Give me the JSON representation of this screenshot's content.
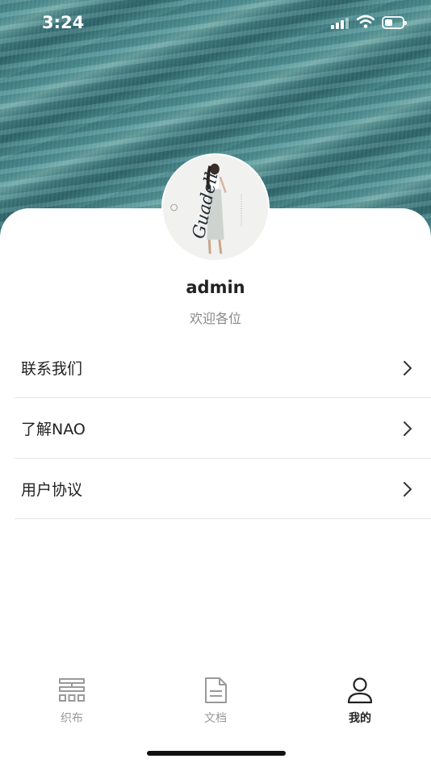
{
  "status_bar": {
    "time": "3:24",
    "battery_level": 0.45
  },
  "profile": {
    "username": "admin",
    "tagline": "欢迎各位",
    "avatar_text": "Guadell"
  },
  "menu": {
    "items": [
      {
        "label": "联系我们"
      },
      {
        "label": "了解NAO"
      },
      {
        "label": "用户协议"
      }
    ]
  },
  "tabbar": {
    "tabs": [
      {
        "label": "织布",
        "icon": "fabric-grid-icon",
        "active": false
      },
      {
        "label": "文档",
        "icon": "document-icon",
        "active": false
      },
      {
        "label": "我的",
        "icon": "person-icon",
        "active": true
      }
    ]
  },
  "colors": {
    "active_tab": "#222222",
    "inactive_tab": "#999999",
    "divider": "#e6e6e6"
  }
}
